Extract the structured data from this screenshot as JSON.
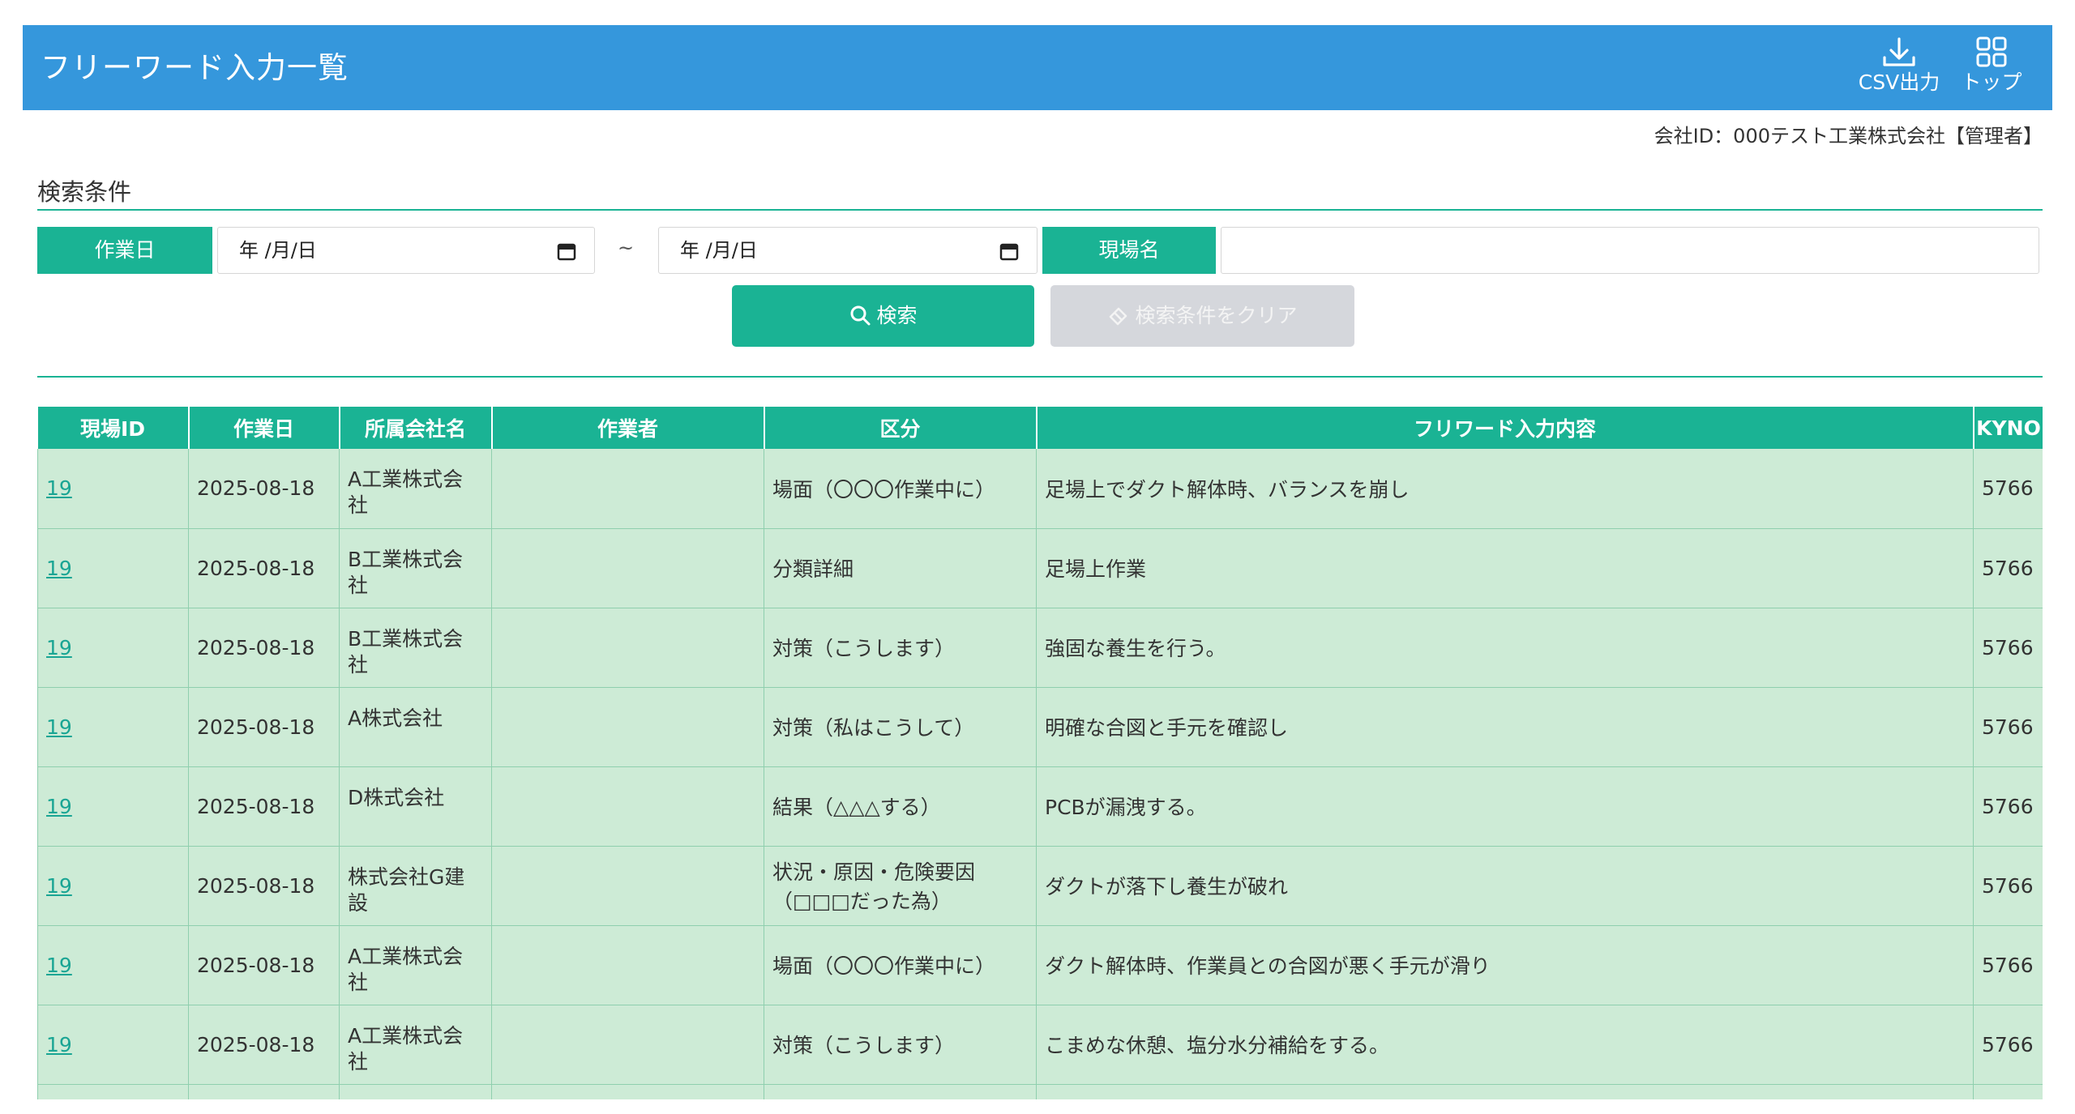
{
  "header": {
    "title": "フリーワード入力一覧",
    "csv_label": "CSV出力",
    "top_label": "トップ",
    "csv_icon": "download-icon",
    "top_icon": "grid-icon"
  },
  "company_info": "会社ID：000テスト工業株式会社【管理者】",
  "search": {
    "section_title": "検索条件",
    "work_date_label": "作業日",
    "date_from_value": "年 /月/日",
    "date_to_value": "年 /月/日",
    "tilde": "~",
    "site_name_label": "現場名",
    "site_name_value": "",
    "search_button": "検索",
    "clear_button": "検索条件をクリア"
  },
  "table": {
    "headers": [
      "現場ID",
      "作業日",
      "所属会社名",
      "作業者",
      "区分",
      "フリワード入力内容",
      "KYNO"
    ],
    "rows": [
      {
        "site_id": "19",
        "date": "2025-08-18",
        "company": "A工業株式会社",
        "worker": "",
        "category": "場面（〇〇〇作業中に）",
        "content": "足場上でダクト解体時、バランスを崩し",
        "kyno": "5766"
      },
      {
        "site_id": "19",
        "date": "2025-08-18",
        "company": "B工業株式会社",
        "worker": "",
        "category": "分類詳細",
        "content": "足場上作業",
        "kyno": "5766"
      },
      {
        "site_id": "19",
        "date": "2025-08-18",
        "company": "B工業株式会社",
        "worker": "",
        "category": "対策（こうします）",
        "content": "強固な養生を行う。",
        "kyno": "5766"
      },
      {
        "site_id": "19",
        "date": "2025-08-18",
        "company": "A株式会社",
        "worker": "",
        "category": "対策（私はこうして）",
        "content": "明確な合図と手元を確認し",
        "kyno": "5766"
      },
      {
        "site_id": "19",
        "date": "2025-08-18",
        "company": "D株式会社",
        "worker": "",
        "category": "結果（△△△する）",
        "content": "PCBが漏洩する。",
        "kyno": "5766"
      },
      {
        "site_id": "19",
        "date": "2025-08-18",
        "company": "株式会社G建設",
        "worker": "",
        "category": "状況・原因・危険要因（□□□だった為）",
        "content": "ダクトが落下し養生が破れ",
        "kyno": "5766"
      },
      {
        "site_id": "19",
        "date": "2025-08-18",
        "company": "A工業株式会社",
        "worker": "",
        "category": "場面（〇〇〇作業中に）",
        "content": "ダクト解体時、作業員との合図が悪く手元が滑り",
        "kyno": "5766"
      },
      {
        "site_id": "19",
        "date": "2025-08-18",
        "company": "A工業株式会社",
        "worker": "",
        "category": "対策（こうします）",
        "content": "こまめな休憩、塩分水分補給をする。",
        "kyno": "5766"
      },
      {
        "site_id": "",
        "date": "",
        "company": "",
        "worker": "",
        "category": "",
        "content": "",
        "kyno": ""
      }
    ]
  }
}
